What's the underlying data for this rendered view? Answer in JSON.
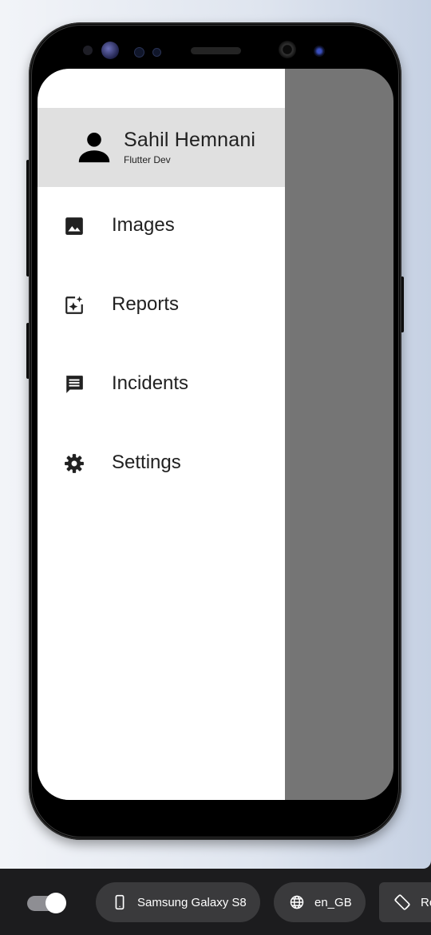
{
  "drawer": {
    "header": {
      "name": "Sahil Hemnani",
      "role": "Flutter Dev",
      "avatar_icon": "person-icon"
    },
    "items": [
      {
        "label": "Images",
        "icon": "image-icon"
      },
      {
        "label": "Reports",
        "icon": "add-photo-sparkle-icon"
      },
      {
        "label": "Incidents",
        "icon": "message-icon"
      },
      {
        "label": "Settings",
        "icon": "gear-icon"
      }
    ]
  },
  "toolbar": {
    "toggle_on": true,
    "device": "Samsung Galaxy S8",
    "locale": "en_GB",
    "rotate_label": "Ro"
  },
  "colors": {
    "drawer_header_bg": "#e0e0e0",
    "scrim": "#757575",
    "text": "#212121"
  }
}
